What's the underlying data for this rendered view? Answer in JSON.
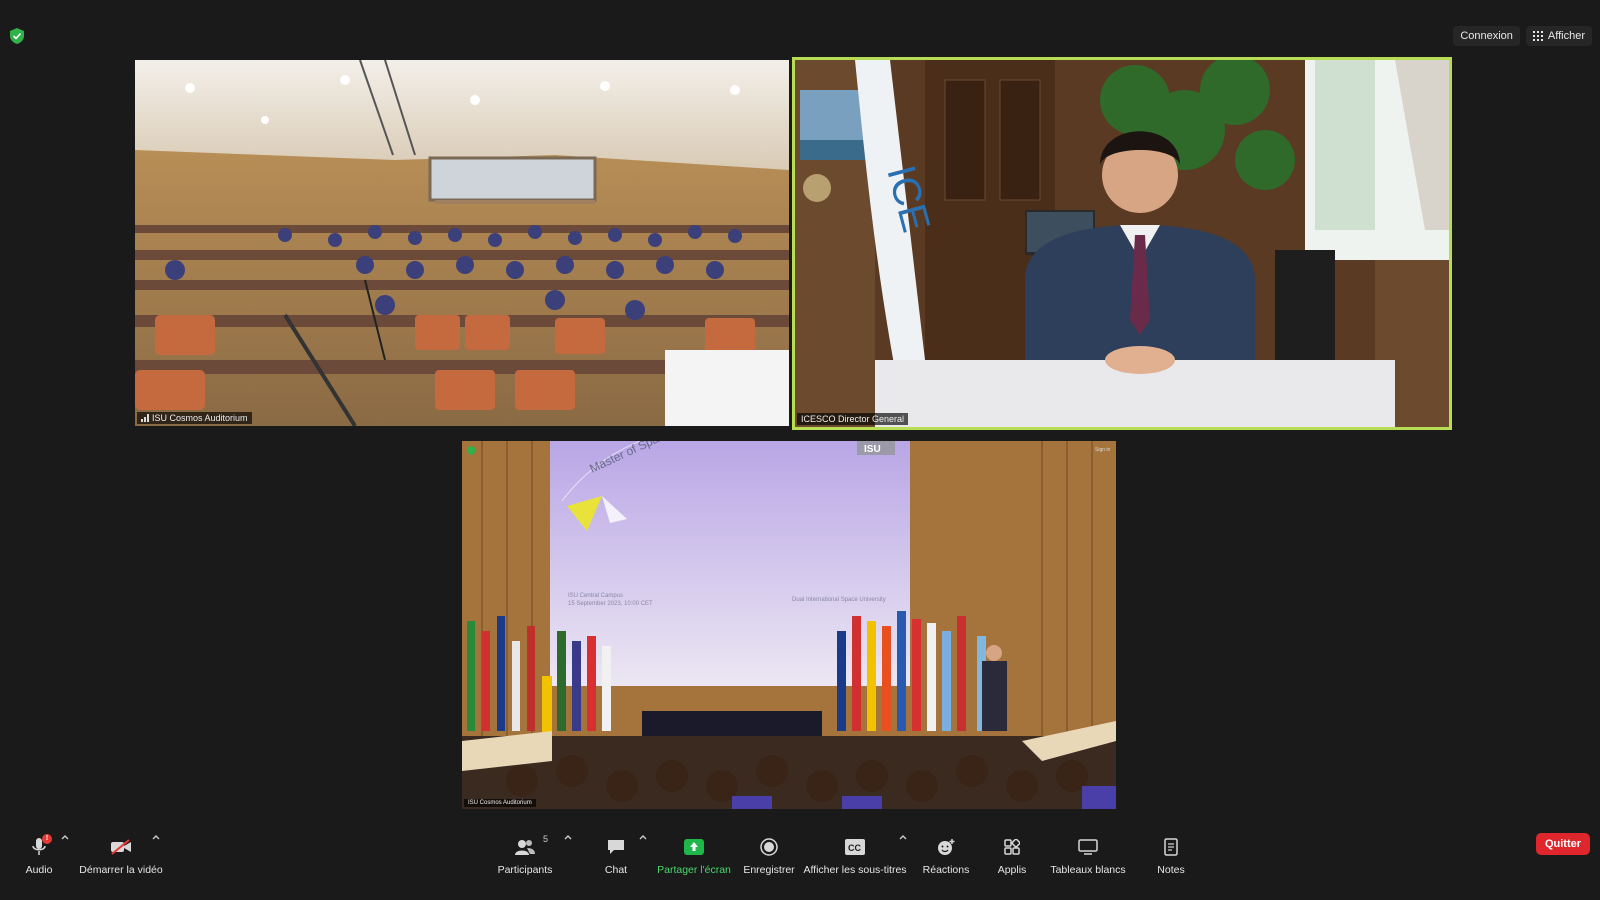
{
  "top_right": {
    "signin_label": "Connexion",
    "view_label": "Afficher"
  },
  "tiles": [
    {
      "name": "ISU Cosmos Auditorium"
    },
    {
      "name": "ICESCO Director General",
      "flag_text": "ICE"
    },
    {
      "name": "ISU Cosmos Auditorium",
      "screen_title": "Master of Space Studies",
      "screen_line1": "ISU Central Campus",
      "screen_line2": "15 September 2023, 10:00 CET",
      "screen_right": "Dual International Space University",
      "logo": "ISU",
      "sign_in": "Sign in"
    }
  ],
  "toolbar": {
    "audio_label": "Audio",
    "audio_alert": "!",
    "video_label": "Démarrer la vidéo",
    "participants_label": "Participants",
    "participants_count": "5",
    "chat_label": "Chat",
    "share_label": "Partager l'écran",
    "record_label": "Enregistrer",
    "captions_label": "Afficher les sous-titres",
    "captions_icon_text": "CC",
    "reactions_label": "Réactions",
    "apps_label": "Applis",
    "whiteboards_label": "Tableaux blancs",
    "notes_label": "Notes",
    "leave_label": "Quitter"
  },
  "colors": {
    "active_speaker_border": "#b7dd55",
    "share_green": "#47d86b",
    "leave_red": "#e0262d",
    "background": "#1a1a1a"
  }
}
